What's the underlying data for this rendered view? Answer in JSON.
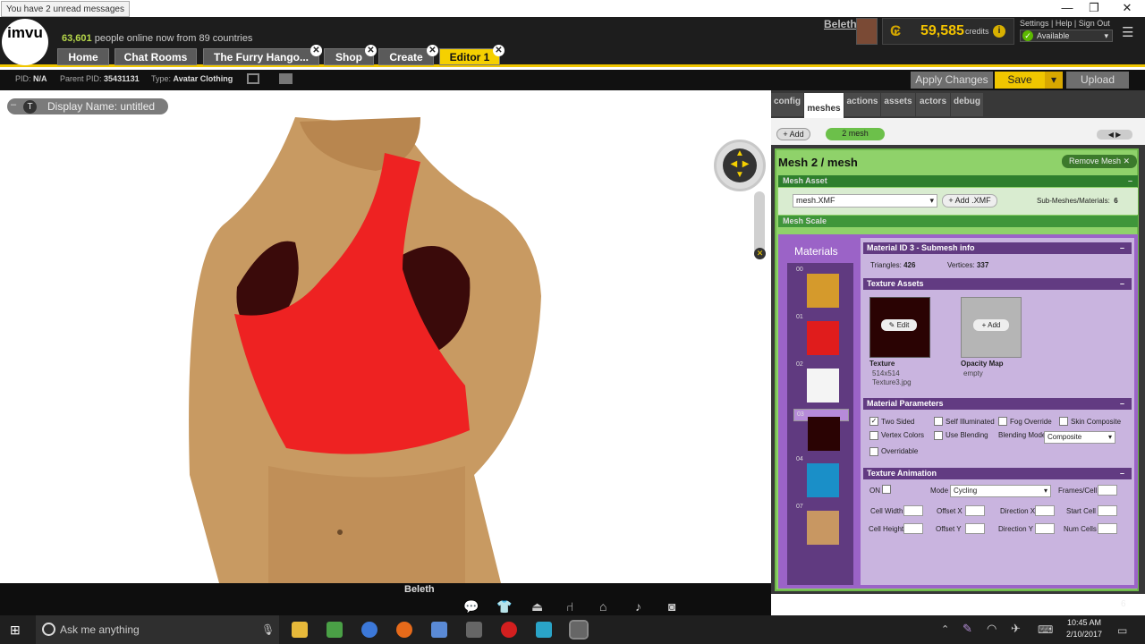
{
  "window": {
    "notice": "You have 2 unread messages",
    "controls": [
      "—",
      "❐",
      "✕"
    ]
  },
  "header": {
    "logo": "imvu",
    "online_count": "63,601",
    "online_text": " people online now from 89 countries",
    "tabs": [
      {
        "label": "Home",
        "closable": false
      },
      {
        "label": "Chat Rooms",
        "closable": true
      },
      {
        "label": "The Furry Hango...",
        "closable": true
      },
      {
        "label": "Shop",
        "closable": true
      },
      {
        "label": "Create",
        "closable": true
      },
      {
        "label": "Editor 1",
        "closable": true,
        "active": true
      }
    ],
    "username": "Beleth",
    "credits": "59,585",
    "credits_label": "credits",
    "links": "Settings | Help | Sign Out",
    "status": "Available"
  },
  "infobar": {
    "pid_label": "PID:",
    "pid": "N/A",
    "parent_label": "Parent PID:",
    "parent": "35431131",
    "type_label": "Type:",
    "type": "Avatar Clothing",
    "apply": "Apply Changes",
    "save": "Save",
    "upload": "Upload"
  },
  "viewport": {
    "display_name": "Display Name: untitled",
    "dock_name": "Beleth"
  },
  "panel": {
    "tabs": [
      "config",
      "meshes",
      "actions",
      "assets",
      "actors",
      "debug"
    ],
    "active_tab": "meshes",
    "add": "+ Add",
    "mesh_tab": "2 mesh",
    "title": "Mesh 2 / mesh",
    "remove": "Remove Mesh ✕",
    "mesh_asset_title": "Mesh Asset",
    "mesh_file": "mesh.XMF",
    "add_xmf": "+ Add .XMF",
    "submesh_label": "Sub-Meshes/Materials:",
    "submesh_count": "6",
    "mesh_scale": "Mesh Scale",
    "materials_title": "Materials",
    "material_ids": [
      "00",
      "01",
      "02",
      "03",
      "04",
      "07"
    ],
    "material_info_title": "Material ID 3 - Submesh info",
    "triangles_label": "Triangles:",
    "triangles": "426",
    "vertices_label": "Vertices:",
    "vertices": "337",
    "texture_assets_title": "Texture Assets",
    "texture_label": "Texture",
    "texture_size": "514x514",
    "texture_file": "Texture3.jpg",
    "edit": "Edit",
    "opacity_label": "Opacity Map",
    "opacity_value": "empty",
    "opacity_add": "+ Add",
    "params_title": "Material Parameters",
    "params": {
      "two_sided": "Two Sided",
      "self_illuminated": "Self Illuminated",
      "fog_override": "Fog Override",
      "skin_composite": "Skin Composite",
      "vertex_colors": "Vertex Colors",
      "use_blending": "Use Blending",
      "blending_mode_label": "Blending Mode",
      "blending_mode": "Composite",
      "overridable": "Overridable"
    },
    "anim_title": "Texture Animation",
    "anim": {
      "on": "ON",
      "mode_label": "Mode",
      "mode": "Cycling",
      "frames_per_cell": "Frames/Cell",
      "cell_width": "Cell Width",
      "offset_x": "Offset X",
      "direction_x": "Direction X",
      "start_cell": "Start Cell",
      "cell_height": "Cell Height",
      "offset_y": "Offset Y",
      "direction_y": "Direction Y",
      "num_cells": "Num Cells"
    }
  },
  "taskbar": {
    "search": "Ask me anything",
    "time": "10:45 AM",
    "date": "2/10/2017",
    "badge": "6"
  },
  "colors": {
    "accent": "#f5d000",
    "green": "#8fd26a",
    "purple": "#9b63c7"
  }
}
